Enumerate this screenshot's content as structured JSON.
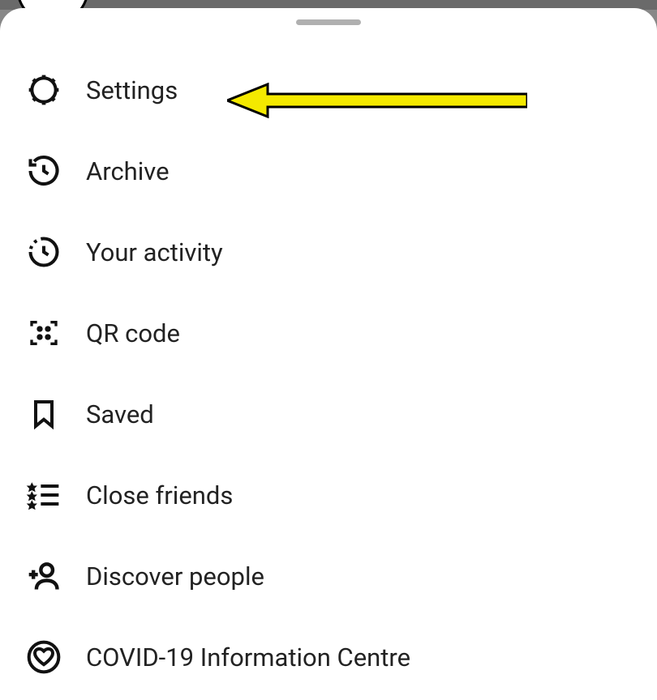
{
  "menu": {
    "items": [
      {
        "key": "settings",
        "label": "Settings",
        "icon": "gear"
      },
      {
        "key": "archive",
        "label": "Archive",
        "icon": "history"
      },
      {
        "key": "your-activity",
        "label": "Your activity",
        "icon": "activity-clock"
      },
      {
        "key": "qr-code",
        "label": "QR code",
        "icon": "qr"
      },
      {
        "key": "saved",
        "label": "Saved",
        "icon": "bookmark"
      },
      {
        "key": "close-friends",
        "label": "Close friends",
        "icon": "star-list"
      },
      {
        "key": "discover-people",
        "label": "Discover people",
        "icon": "add-person"
      },
      {
        "key": "covid-info",
        "label": "COVID-19 Information Centre",
        "icon": "heart-badge"
      }
    ]
  },
  "annotation": {
    "target": "settings",
    "arrow_color": "#f4e900",
    "arrow_stroke": "#000000"
  }
}
